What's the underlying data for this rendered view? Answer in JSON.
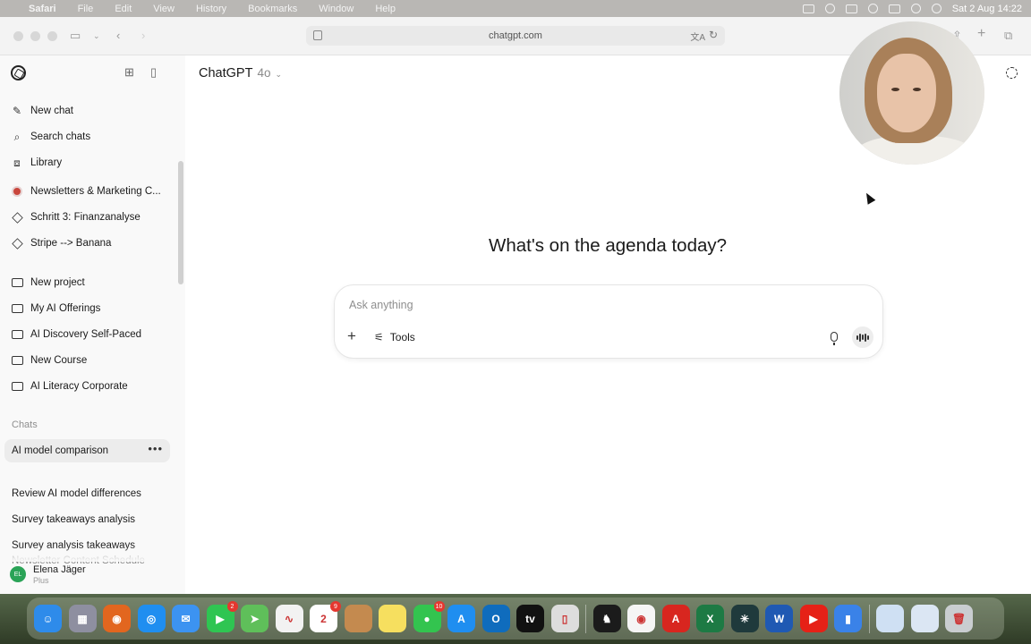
{
  "menubar": {
    "app": "Safari",
    "items": [
      "File",
      "Edit",
      "View",
      "History",
      "Bookmarks",
      "Window",
      "Help"
    ],
    "clock": "Sat 2 Aug  14:22"
  },
  "browser": {
    "url": "chatgpt.com"
  },
  "sidebar": {
    "nav": [
      {
        "label": "New chat",
        "icon": "edit-icon"
      },
      {
        "label": "Search chats",
        "icon": "search-icon"
      },
      {
        "label": "Library",
        "icon": "library-icon"
      }
    ],
    "gpts": [
      {
        "label": "Newsletters & Marketing C...",
        "icon": "gpt-avatar-icon"
      },
      {
        "label": "Schritt 3: Finanzanalyse",
        "icon": "cube-icon"
      },
      {
        "label": "Stripe --> Banana",
        "icon": "cube-icon"
      }
    ],
    "projects": [
      {
        "label": "New project",
        "icon": "new-folder-icon"
      },
      {
        "label": "My AI Offerings",
        "icon": "folder-icon"
      },
      {
        "label": "AI Discovery Self-Paced",
        "icon": "folder-icon"
      },
      {
        "label": "New Course",
        "icon": "folder-icon"
      },
      {
        "label": "AI Literacy Corporate",
        "icon": "folder-icon"
      }
    ],
    "chats_heading": "Chats",
    "chats": [
      {
        "label": "AI model comparison",
        "active": true
      },
      {
        "label": "Review AI model differences"
      },
      {
        "label": "Survey takeaways analysis"
      },
      {
        "label": "Survey analysis takeaways"
      },
      {
        "label": "Newsletter Content Schedule"
      }
    ],
    "user": {
      "initials": "EL",
      "name": "Elena Jäger",
      "plan": "Plus"
    }
  },
  "main": {
    "model_name": "ChatGPT",
    "model_version": "4o",
    "headline": "What's on the agenda today?",
    "composer": {
      "placeholder": "Ask anything",
      "value": "",
      "tools_label": "Tools"
    }
  },
  "dock": {
    "apps": [
      {
        "name": "Finder",
        "color": "#2e8bea",
        "glyph": "☺"
      },
      {
        "name": "Launchpad",
        "color": "#8e8fa0",
        "glyph": "▦"
      },
      {
        "name": "Firefox",
        "color": "#e2661f",
        "glyph": "◉"
      },
      {
        "name": "Safari",
        "color": "#1f8ef0",
        "glyph": "◎"
      },
      {
        "name": "Mail",
        "color": "#3c93f1",
        "glyph": "✉"
      },
      {
        "name": "FaceTime",
        "color": "#2fc552",
        "glyph": "▶",
        "badge": "2"
      },
      {
        "name": "Maps",
        "color": "#5fbf5a",
        "glyph": "➤"
      },
      {
        "name": "Freeform",
        "color": "#f2f2f2",
        "glyph": "∿"
      },
      {
        "name": "Calendar",
        "color": "#ffffff",
        "glyph": "2",
        "badge": "9"
      },
      {
        "name": "Notes Folder",
        "color": "#c48a4f",
        "glyph": ""
      },
      {
        "name": "Notes",
        "color": "#f6df5f",
        "glyph": ""
      },
      {
        "name": "Messages",
        "color": "#33c44f",
        "glyph": "●",
        "badge": "10"
      },
      {
        "name": "App Store",
        "color": "#1f8ef0",
        "glyph": "A"
      },
      {
        "name": "Outlook",
        "color": "#0f6cbd",
        "glyph": "O"
      },
      {
        "name": "Apple TV",
        "color": "#111111",
        "glyph": "tv"
      },
      {
        "name": "iPhone Mirroring",
        "color": "#dddddd",
        "glyph": "▯"
      },
      {
        "name": "Elephant App",
        "color": "#1b1b1b",
        "glyph": "♞"
      },
      {
        "name": "Chrome",
        "color": "#f5f5f5",
        "glyph": "◉"
      },
      {
        "name": "Acrobat",
        "color": "#d8261f",
        "glyph": "A"
      },
      {
        "name": "Excel",
        "color": "#1d7a44",
        "glyph": "X"
      },
      {
        "name": "Perplexity",
        "color": "#1f3a3c",
        "glyph": "✳"
      },
      {
        "name": "Word",
        "color": "#1f59b3",
        "glyph": "W"
      },
      {
        "name": "YouTube",
        "color": "#e62117",
        "glyph": "▶"
      },
      {
        "name": "Voice Memos",
        "color": "#3a82e8",
        "glyph": "▮"
      }
    ],
    "trailing": [
      {
        "name": "Recent Window 1",
        "color": "#cfe0f3",
        "glyph": ""
      },
      {
        "name": "Recent Window 2",
        "color": "#dbe6f3",
        "glyph": ""
      },
      {
        "name": "Trash",
        "color": "#c9cdd0",
        "glyph": "🗑"
      }
    ]
  }
}
